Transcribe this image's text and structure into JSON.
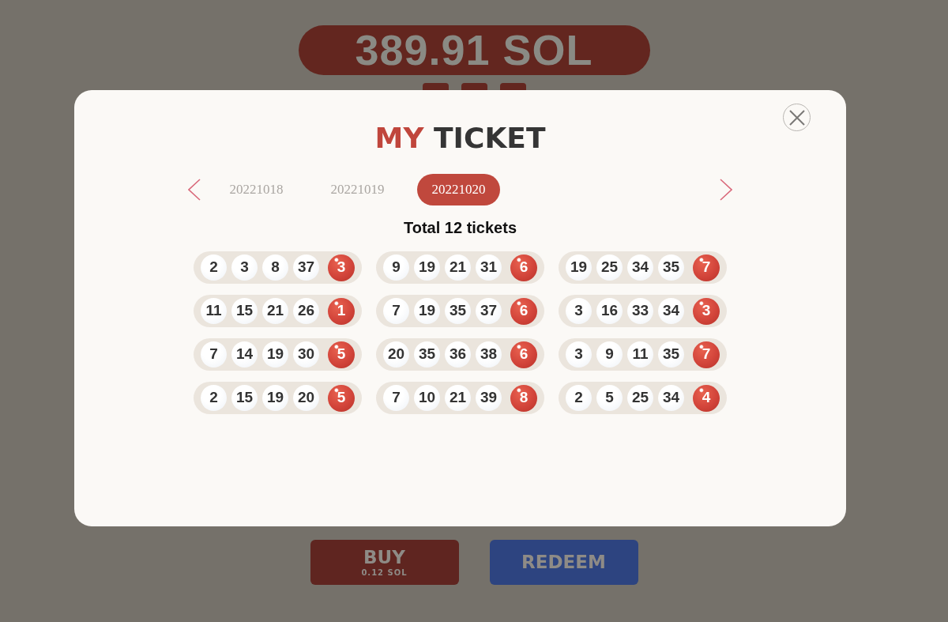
{
  "jackpot": {
    "amount": "389.91 SOL"
  },
  "modal": {
    "title_accent": "MY",
    "title": "TICKET",
    "dates": [
      {
        "label": "20221018",
        "selected": false
      },
      {
        "label": "20221019",
        "selected": false
      },
      {
        "label": "20221020",
        "selected": true
      }
    ],
    "total": "Total 12 tickets",
    "tickets": [
      {
        "numbers": [
          "2",
          "3",
          "8",
          "37"
        ],
        "bonus": "3"
      },
      {
        "numbers": [
          "9",
          "19",
          "21",
          "31"
        ],
        "bonus": "6"
      },
      {
        "numbers": [
          "19",
          "25",
          "34",
          "35"
        ],
        "bonus": "7"
      },
      {
        "numbers": [
          "11",
          "15",
          "21",
          "26"
        ],
        "bonus": "1"
      },
      {
        "numbers": [
          "7",
          "19",
          "35",
          "37"
        ],
        "bonus": "6"
      },
      {
        "numbers": [
          "3",
          "16",
          "33",
          "34"
        ],
        "bonus": "3"
      },
      {
        "numbers": [
          "7",
          "14",
          "19",
          "30"
        ],
        "bonus": "5"
      },
      {
        "numbers": [
          "20",
          "35",
          "36",
          "38"
        ],
        "bonus": "6"
      },
      {
        "numbers": [
          "3",
          "9",
          "11",
          "35"
        ],
        "bonus": "7"
      },
      {
        "numbers": [
          "2",
          "15",
          "19",
          "20"
        ],
        "bonus": "5"
      },
      {
        "numbers": [
          "7",
          "10",
          "21",
          "39"
        ],
        "bonus": "8"
      },
      {
        "numbers": [
          "2",
          "5",
          "25",
          "34"
        ],
        "bonus": "4"
      }
    ]
  },
  "buttons": [
    {
      "kind": "buy",
      "label": "BUY",
      "sublabel": "0.12 SOL"
    },
    {
      "kind": "redeem",
      "label": "REDEEM"
    }
  ]
}
